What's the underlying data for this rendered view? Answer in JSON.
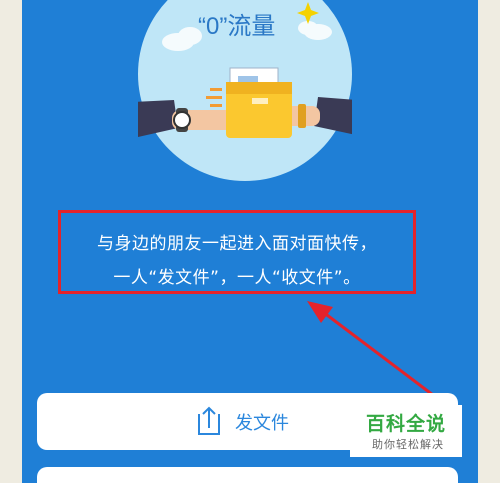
{
  "hero": {
    "badge_text": "“0”流量"
  },
  "description": {
    "line1": "与身边的朋友一起进入面对面快传，",
    "line2": "一人“发文件”，一人“收文件”。"
  },
  "actions": {
    "send_label": "发文件"
  },
  "watermark": {
    "main": "百科全说",
    "sub": "助你轻松解决"
  },
  "colors": {
    "background": "#1f7fd6",
    "highlight_box": "#e4232b",
    "accent": "#2b87dd",
    "watermark_green": "#33a942"
  }
}
